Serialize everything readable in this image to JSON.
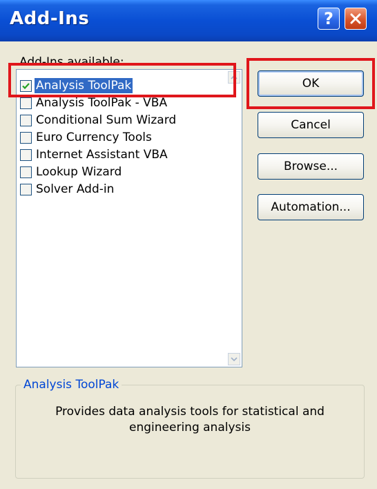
{
  "window": {
    "title": "Add-Ins",
    "help_symbol": "?"
  },
  "addins": {
    "caption": "Add-Ins available:",
    "items": [
      {
        "label": "Analysis ToolPak",
        "checked": true,
        "selected": true
      },
      {
        "label": "Analysis ToolPak - VBA",
        "checked": false,
        "selected": false
      },
      {
        "label": "Conditional Sum Wizard",
        "checked": false,
        "selected": false
      },
      {
        "label": "Euro Currency Tools",
        "checked": false,
        "selected": false
      },
      {
        "label": "Internet Assistant VBA",
        "checked": false,
        "selected": false
      },
      {
        "label": "Lookup Wizard",
        "checked": false,
        "selected": false
      },
      {
        "label": "Solver Add-in",
        "checked": false,
        "selected": false
      }
    ]
  },
  "buttons": {
    "ok": "OK",
    "cancel": "Cancel",
    "browse": "Browse...",
    "automation": "Automation..."
  },
  "details": {
    "heading": "Analysis ToolPak",
    "description": "Provides data analysis tools for statistical and engineering analysis"
  },
  "colors": {
    "annotation_box": "#e0161b",
    "selection": "#316ac5",
    "titlebar": "#0a4fd4"
  },
  "icons": [
    "help-icon",
    "close-icon",
    "checkmark-icon",
    "scroll-up-icon",
    "scroll-down-icon"
  ]
}
